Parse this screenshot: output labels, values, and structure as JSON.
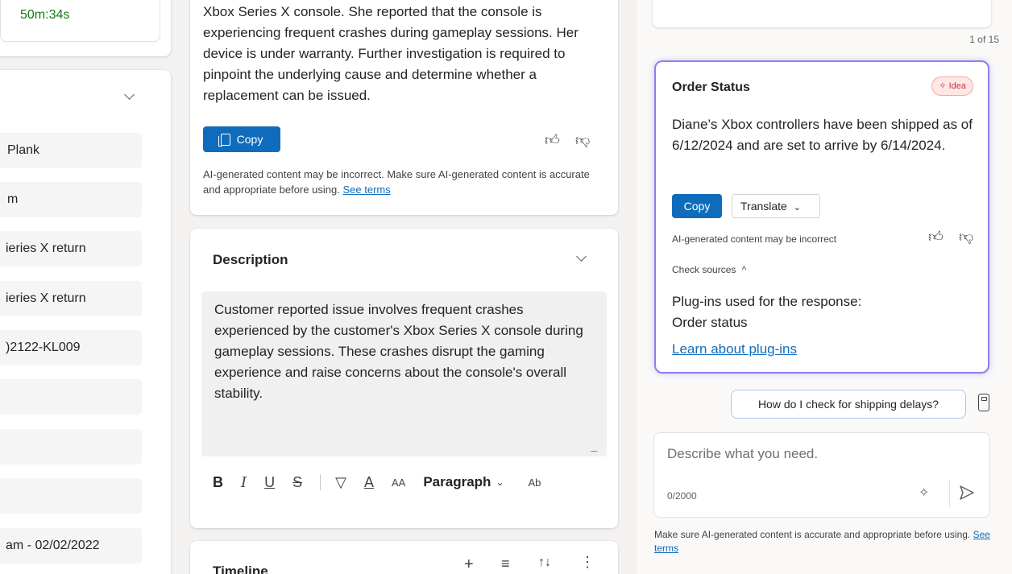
{
  "timer": {
    "value": "50m:34s"
  },
  "fields": [
    "Plank",
    "m",
    "ieries X return",
    "ieries X return",
    ")2122-KL009",
    "",
    "",
    "",
    "am - 02/02/2022"
  ],
  "summary": {
    "text": "Xbox Series X console. She reported that the console is experiencing frequent crashes during gameplay sessions. Her device is under warranty.  Further investigation is required to pinpoint the underlying cause and determine whether a replacement can be issued.",
    "copy_label": "Copy",
    "disclaimer": "AI-generated content may be incorrect. Make sure AI-generated content is accurate and appropriate before using.",
    "see_terms": "See terms"
  },
  "description": {
    "title": "Description",
    "text": "Customer reported issue involves frequent crashes experienced by the customer's Xbox Series X console during gameplay sessions. These crashes disrupt the gaming experience and raise concerns about the console's overall stability.",
    "toolbar": {
      "bold": "B",
      "italic": "I",
      "underline": "U",
      "strike": "S",
      "font_size": "AA",
      "paragraph": "Paragraph",
      "spellcheck": "Ab"
    }
  },
  "timeline": {
    "title": "Timeline"
  },
  "copilot": {
    "pager": "1 of 15",
    "card": {
      "title": "Order Status",
      "badge": "Idea",
      "text": "Diane’s Xbox controllers have been shipped as of 6/12/2024 and are set to arrive by 6/14/2024.",
      "copy_label": "Copy",
      "translate_label": "Translate",
      "disclaimer": "AI-generated content may be incorrect",
      "check_sources": "Check sources",
      "plugins_label": "Plug-ins used for the response:",
      "plugin_name": "Order status",
      "learn_link": "Learn about plug-ins"
    },
    "suggestion": "How do I check for shipping delays?",
    "input": {
      "placeholder": "Describe what you need.",
      "char_count": "0/2000"
    },
    "footer": "Make sure AI-generated content is accurate and appropriate before using.",
    "footer_link": "See terms"
  }
}
